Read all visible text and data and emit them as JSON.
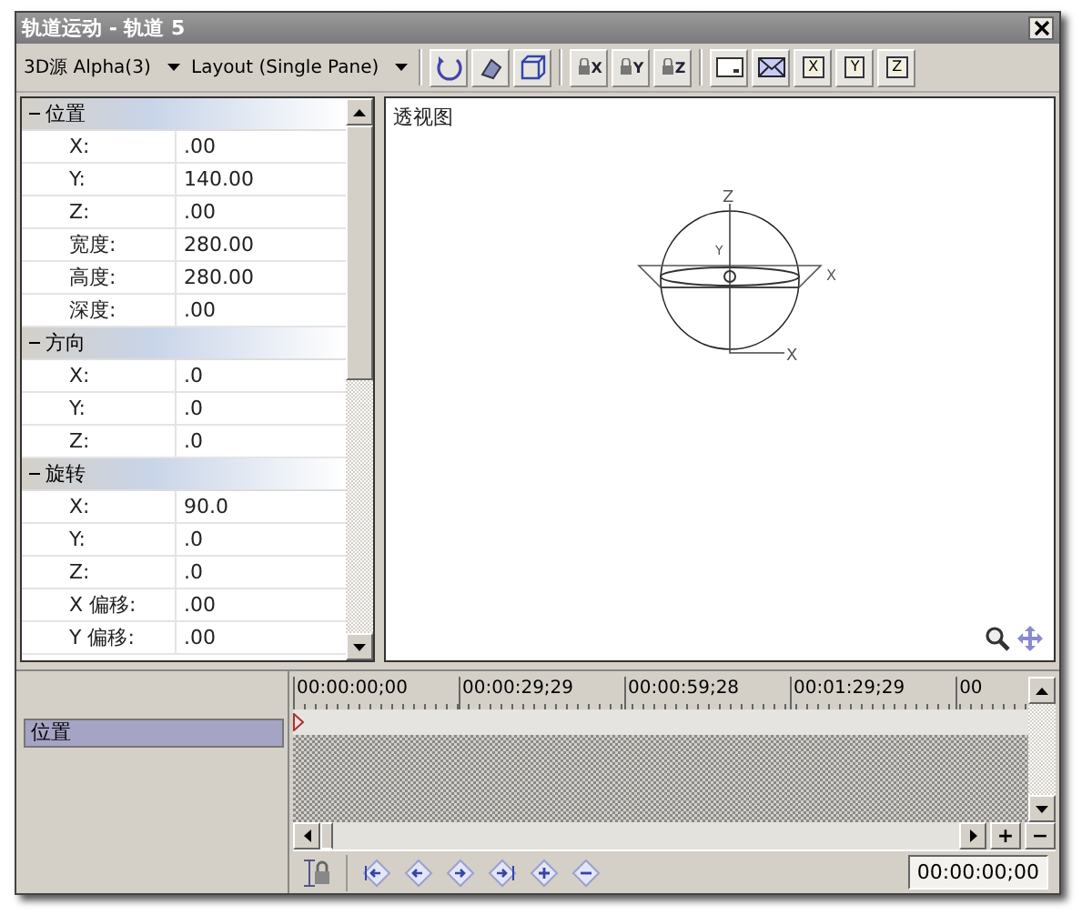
{
  "window": {
    "title": "轨道运动 - 轨道 5"
  },
  "toolbar": {
    "source_dropdown": "3D源 Alpha(3)",
    "layout_dropdown": "Layout (Single Pane)",
    "axis_lock_buttons": [
      "X",
      "Y",
      "Z"
    ],
    "view_buttons": [
      "X",
      "Y",
      "Z"
    ]
  },
  "properties": [
    {
      "label": "位置",
      "expanded": true,
      "rows": [
        {
          "name": "X:",
          "value": ".00"
        },
        {
          "name": "Y:",
          "value": "140.00"
        },
        {
          "name": "Z:",
          "value": ".00"
        },
        {
          "name": "宽度:",
          "value": "280.00"
        },
        {
          "name": "高度:",
          "value": "280.00"
        },
        {
          "name": "深度:",
          "value": ".00"
        }
      ]
    },
    {
      "label": "方向",
      "expanded": true,
      "rows": [
        {
          "name": "X:",
          "value": ".0"
        },
        {
          "name": "Y:",
          "value": ".0"
        },
        {
          "name": "Z:",
          "value": ".0"
        }
      ]
    },
    {
      "label": "旋转",
      "expanded": true,
      "rows": [
        {
          "name": "X:",
          "value": "90.0"
        },
        {
          "name": "Y:",
          "value": ".0"
        },
        {
          "name": "Z:",
          "value": ".0"
        },
        {
          "name": "X 偏移:",
          "value": ".00"
        },
        {
          "name": "Y 偏移:",
          "value": ".00"
        }
      ]
    }
  ],
  "viewport": {
    "label": "透视图",
    "gizmo_labels": [
      "Z",
      "Y",
      "X",
      "X"
    ]
  },
  "timeline": {
    "tracks": [
      {
        "label": "位置",
        "selected": true
      }
    ],
    "ruler": [
      "00:00:00;00",
      "00:00:29;29",
      "00:00:59;28",
      "00:01:29;29",
      "00"
    ],
    "zoom_in": "+",
    "zoom_out": "−",
    "time_display": "00:00:00;00"
  }
}
